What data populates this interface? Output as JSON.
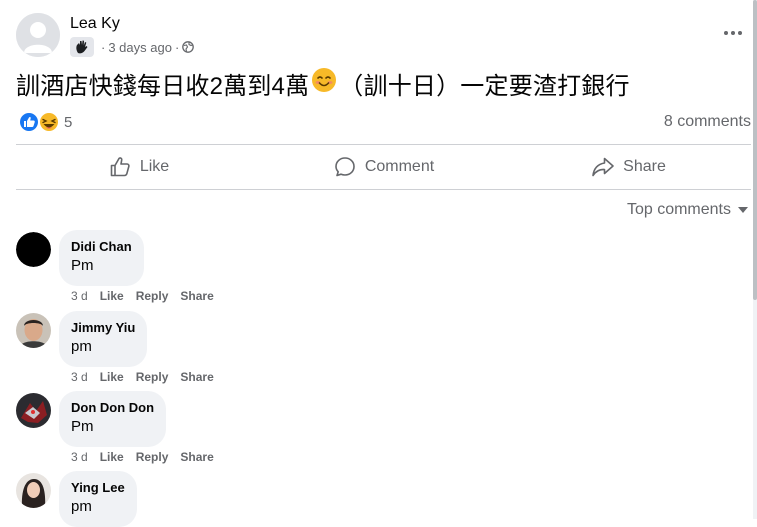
{
  "post": {
    "author": "Lea Ky",
    "time": "3 days ago",
    "text_part1": "訓酒店快錢每日收2萬到4萬",
    "text_part2": "（訓十日）一定要渣打銀行",
    "reaction_count": "5",
    "comments_count": "8 comments"
  },
  "actions": {
    "like": "Like",
    "comment": "Comment",
    "share": "Share"
  },
  "sort_label": "Top comments",
  "comment_action_labels": {
    "time": "3 d",
    "like": "Like",
    "reply": "Reply",
    "share": "Share"
  },
  "comments": [
    {
      "name": "Didi Chan",
      "text": "Pm"
    },
    {
      "name": "Jimmy Yiu",
      "text": "pm"
    },
    {
      "name": "Don Don Don",
      "text": "Pm"
    },
    {
      "name": "Ying Lee",
      "text": "pm"
    }
  ],
  "icons": {
    "author_avatar": "person-silhouette-icon",
    "group_badge": "hand-wave-icon",
    "privacy": "globe-icon",
    "more": "more-horizontal-icon",
    "inline_emoji": "smiling-face-icon",
    "reaction_like": "thumbs-up-icon",
    "reaction_haha": "laughing-face-icon",
    "like": "thumbs-up-outline-icon",
    "comment": "speech-bubble-icon",
    "share": "share-arrow-icon",
    "sort": "caret-down-icon"
  },
  "colors": {
    "like_blue": "#1877f2",
    "haha_yellow": "#f7b928",
    "secondary_text": "#65676b",
    "bubble_bg": "#f0f2f5"
  }
}
